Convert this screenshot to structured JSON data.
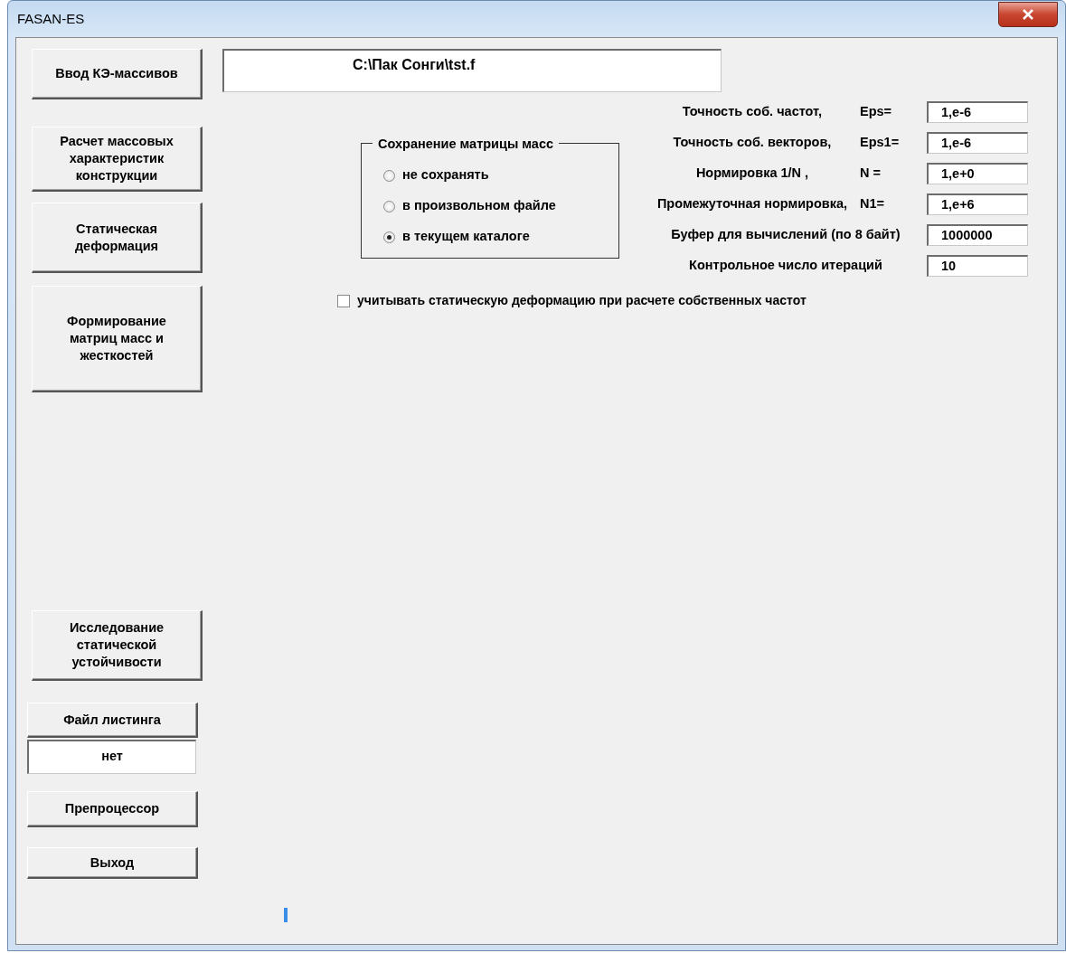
{
  "window": {
    "title": "FASAN-ES"
  },
  "nav_buttons": [
    {
      "label": "Ввод КЭ-массивов"
    },
    {
      "label": "Расчет массовых\nхарактеристик\nконструкции"
    },
    {
      "label": "Статическая\nдеформация"
    },
    {
      "label": "Формирование\nматриц масс и\nжесткостей"
    },
    {
      "label": "Исследование\nстатической\nустойчивости"
    }
  ],
  "listing": {
    "button": "Файл листинга",
    "value": "нет"
  },
  "bottom_buttons": [
    "Препроцессор",
    "Выход"
  ],
  "path_field": {
    "value": "C:\\Пак Сонги\\tst.f"
  },
  "mass_matrix_group": {
    "title": "Сохранение матрицы масс",
    "options": [
      {
        "label": "не сохранять",
        "selected": false
      },
      {
        "label": "в произвольном файле",
        "selected": false
      },
      {
        "label": "в текущем каталоге",
        "selected": true
      }
    ]
  },
  "parameters": [
    {
      "label": "Точность соб. частот,",
      "symbol": "Eps=",
      "value": "1,e-6"
    },
    {
      "label": "Точность соб. векторов,",
      "symbol": "Eps1=",
      "value": "1,e-6"
    },
    {
      "label": "Нормировка  1/N ,",
      "symbol": "N =",
      "value": "1,e+0"
    },
    {
      "label": "Промежуточная нормировка,",
      "symbol": "N1=",
      "value": "1,e+6"
    },
    {
      "label": "Буфер для вычислений (по 8 байт)",
      "value": "1000000"
    },
    {
      "label": "Контрольное число итераций",
      "value": "10"
    }
  ],
  "static_deformation_checkbox": {
    "label": "учитывать статическую деформацию при расчете собственных частот",
    "checked": false
  }
}
